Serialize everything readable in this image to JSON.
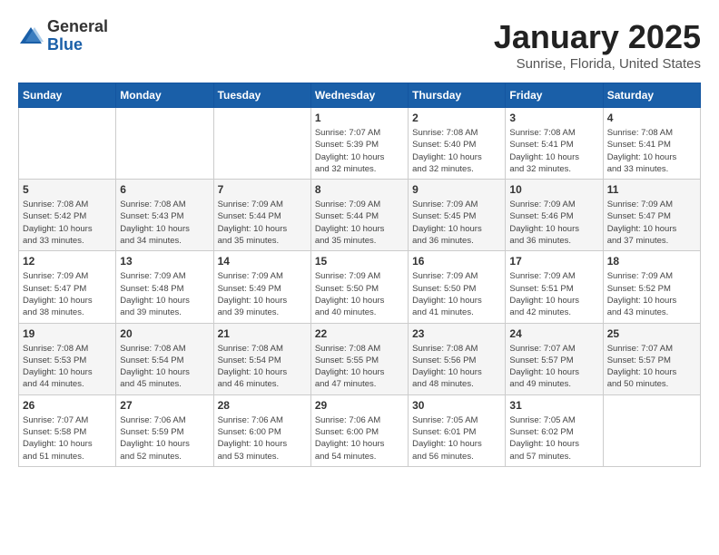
{
  "logo": {
    "general": "General",
    "blue": "Blue"
  },
  "header": {
    "title": "January 2025",
    "location": "Sunrise, Florida, United States"
  },
  "weekdays": [
    "Sunday",
    "Monday",
    "Tuesday",
    "Wednesday",
    "Thursday",
    "Friday",
    "Saturday"
  ],
  "weeks": [
    [
      {
        "day": "",
        "info": ""
      },
      {
        "day": "",
        "info": ""
      },
      {
        "day": "",
        "info": ""
      },
      {
        "day": "1",
        "info": "Sunrise: 7:07 AM\nSunset: 5:39 PM\nDaylight: 10 hours\nand 32 minutes."
      },
      {
        "day": "2",
        "info": "Sunrise: 7:08 AM\nSunset: 5:40 PM\nDaylight: 10 hours\nand 32 minutes."
      },
      {
        "day": "3",
        "info": "Sunrise: 7:08 AM\nSunset: 5:41 PM\nDaylight: 10 hours\nand 32 minutes."
      },
      {
        "day": "4",
        "info": "Sunrise: 7:08 AM\nSunset: 5:41 PM\nDaylight: 10 hours\nand 33 minutes."
      }
    ],
    [
      {
        "day": "5",
        "info": "Sunrise: 7:08 AM\nSunset: 5:42 PM\nDaylight: 10 hours\nand 33 minutes."
      },
      {
        "day": "6",
        "info": "Sunrise: 7:08 AM\nSunset: 5:43 PM\nDaylight: 10 hours\nand 34 minutes."
      },
      {
        "day": "7",
        "info": "Sunrise: 7:09 AM\nSunset: 5:44 PM\nDaylight: 10 hours\nand 35 minutes."
      },
      {
        "day": "8",
        "info": "Sunrise: 7:09 AM\nSunset: 5:44 PM\nDaylight: 10 hours\nand 35 minutes."
      },
      {
        "day": "9",
        "info": "Sunrise: 7:09 AM\nSunset: 5:45 PM\nDaylight: 10 hours\nand 36 minutes."
      },
      {
        "day": "10",
        "info": "Sunrise: 7:09 AM\nSunset: 5:46 PM\nDaylight: 10 hours\nand 36 minutes."
      },
      {
        "day": "11",
        "info": "Sunrise: 7:09 AM\nSunset: 5:47 PM\nDaylight: 10 hours\nand 37 minutes."
      }
    ],
    [
      {
        "day": "12",
        "info": "Sunrise: 7:09 AM\nSunset: 5:47 PM\nDaylight: 10 hours\nand 38 minutes."
      },
      {
        "day": "13",
        "info": "Sunrise: 7:09 AM\nSunset: 5:48 PM\nDaylight: 10 hours\nand 39 minutes."
      },
      {
        "day": "14",
        "info": "Sunrise: 7:09 AM\nSunset: 5:49 PM\nDaylight: 10 hours\nand 39 minutes."
      },
      {
        "day": "15",
        "info": "Sunrise: 7:09 AM\nSunset: 5:50 PM\nDaylight: 10 hours\nand 40 minutes."
      },
      {
        "day": "16",
        "info": "Sunrise: 7:09 AM\nSunset: 5:50 PM\nDaylight: 10 hours\nand 41 minutes."
      },
      {
        "day": "17",
        "info": "Sunrise: 7:09 AM\nSunset: 5:51 PM\nDaylight: 10 hours\nand 42 minutes."
      },
      {
        "day": "18",
        "info": "Sunrise: 7:09 AM\nSunset: 5:52 PM\nDaylight: 10 hours\nand 43 minutes."
      }
    ],
    [
      {
        "day": "19",
        "info": "Sunrise: 7:08 AM\nSunset: 5:53 PM\nDaylight: 10 hours\nand 44 minutes."
      },
      {
        "day": "20",
        "info": "Sunrise: 7:08 AM\nSunset: 5:54 PM\nDaylight: 10 hours\nand 45 minutes."
      },
      {
        "day": "21",
        "info": "Sunrise: 7:08 AM\nSunset: 5:54 PM\nDaylight: 10 hours\nand 46 minutes."
      },
      {
        "day": "22",
        "info": "Sunrise: 7:08 AM\nSunset: 5:55 PM\nDaylight: 10 hours\nand 47 minutes."
      },
      {
        "day": "23",
        "info": "Sunrise: 7:08 AM\nSunset: 5:56 PM\nDaylight: 10 hours\nand 48 minutes."
      },
      {
        "day": "24",
        "info": "Sunrise: 7:07 AM\nSunset: 5:57 PM\nDaylight: 10 hours\nand 49 minutes."
      },
      {
        "day": "25",
        "info": "Sunrise: 7:07 AM\nSunset: 5:57 PM\nDaylight: 10 hours\nand 50 minutes."
      }
    ],
    [
      {
        "day": "26",
        "info": "Sunrise: 7:07 AM\nSunset: 5:58 PM\nDaylight: 10 hours\nand 51 minutes."
      },
      {
        "day": "27",
        "info": "Sunrise: 7:06 AM\nSunset: 5:59 PM\nDaylight: 10 hours\nand 52 minutes."
      },
      {
        "day": "28",
        "info": "Sunrise: 7:06 AM\nSunset: 6:00 PM\nDaylight: 10 hours\nand 53 minutes."
      },
      {
        "day": "29",
        "info": "Sunrise: 7:06 AM\nSunset: 6:00 PM\nDaylight: 10 hours\nand 54 minutes."
      },
      {
        "day": "30",
        "info": "Sunrise: 7:05 AM\nSunset: 6:01 PM\nDaylight: 10 hours\nand 56 minutes."
      },
      {
        "day": "31",
        "info": "Sunrise: 7:05 AM\nSunset: 6:02 PM\nDaylight: 10 hours\nand 57 minutes."
      },
      {
        "day": "",
        "info": ""
      }
    ]
  ]
}
